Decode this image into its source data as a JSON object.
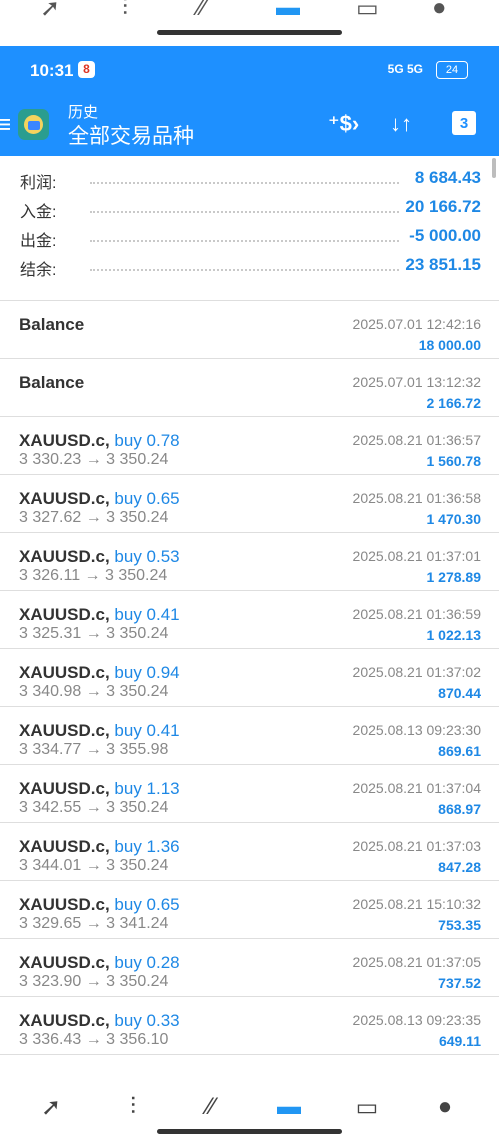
{
  "status": {
    "time": "10:31",
    "notif": "8",
    "signal": "5G 5G",
    "battery": "24"
  },
  "appbar": {
    "subtitle": "历史",
    "title": "全部交易品种",
    "icons": [
      "menu-icon",
      "app-logo",
      "currency-icon",
      "sort-icon",
      "calendar-icon"
    ],
    "calendar_day": "3"
  },
  "summary": [
    {
      "label": "利润:",
      "value": "8 684.43"
    },
    {
      "label": "入金:",
      "value": "20 166.72"
    },
    {
      "label": "出金:",
      "value": "-5 000.00"
    },
    {
      "label": "结余:",
      "value": "23 851.15"
    }
  ],
  "deals": [
    {
      "symbol": "Balance",
      "side": "",
      "prices": "",
      "time": "2025.07.01 12:42:16",
      "profit": "18 000.00"
    },
    {
      "symbol": "Balance",
      "side": "",
      "prices": "",
      "time": "2025.07.01 13:12:32",
      "profit": "2 166.72"
    },
    {
      "symbol": "XAUUSD.c,",
      "side": "buy 0.78",
      "prices": "3 330.23 → 3 350.24",
      "time": "2025.08.21 01:36:57",
      "profit": "1 560.78"
    },
    {
      "symbol": "XAUUSD.c,",
      "side": "buy 0.65",
      "prices": "3 327.62 → 3 350.24",
      "time": "2025.08.21 01:36:58",
      "profit": "1 470.30"
    },
    {
      "symbol": "XAUUSD.c,",
      "side": "buy 0.53",
      "prices": "3 326.11 → 3 350.24",
      "time": "2025.08.21 01:37:01",
      "profit": "1 278.89"
    },
    {
      "symbol": "XAUUSD.c,",
      "side": "buy 0.41",
      "prices": "3 325.31 → 3 350.24",
      "time": "2025.08.21 01:36:59",
      "profit": "1 022.13"
    },
    {
      "symbol": "XAUUSD.c,",
      "side": "buy 0.94",
      "prices": "3 340.98 → 3 350.24",
      "time": "2025.08.21 01:37:02",
      "profit": "870.44"
    },
    {
      "symbol": "XAUUSD.c,",
      "side": "buy 0.41",
      "prices": "3 334.77 → 3 355.98",
      "time": "2025.08.13 09:23:30",
      "profit": "869.61"
    },
    {
      "symbol": "XAUUSD.c,",
      "side": "buy 1.13",
      "prices": "3 342.55 → 3 350.24",
      "time": "2025.08.21 01:37:04",
      "profit": "868.97"
    },
    {
      "symbol": "XAUUSD.c,",
      "side": "buy 1.36",
      "prices": "3 344.01 → 3 350.24",
      "time": "2025.08.21 01:37:03",
      "profit": "847.28"
    },
    {
      "symbol": "XAUUSD.c,",
      "side": "buy 0.65",
      "prices": "3 329.65 → 3 341.24",
      "time": "2025.08.21 15:10:32",
      "profit": "753.35"
    },
    {
      "symbol": "XAUUSD.c,",
      "side": "buy 0.28",
      "prices": "3 323.90 → 3 350.24",
      "time": "2025.08.21 01:37:05",
      "profit": "737.52"
    },
    {
      "symbol": "XAUUSD.c,",
      "side": "buy 0.33",
      "prices": "3 336.43 → 3 356.10",
      "time": "2025.08.13 09:23:35",
      "profit": "649.11"
    }
  ],
  "bottom_nav": [
    {
      "name": "quotes-icon",
      "active": false
    },
    {
      "name": "chart-icon",
      "active": false
    },
    {
      "name": "trade-icon",
      "active": false
    },
    {
      "name": "history-icon",
      "active": true
    },
    {
      "name": "news-icon",
      "active": false
    },
    {
      "name": "messages-icon",
      "active": false
    }
  ],
  "colors": {
    "accent": "#1e90ff",
    "value_blue": "#1e88e5",
    "muted": "#888888"
  }
}
